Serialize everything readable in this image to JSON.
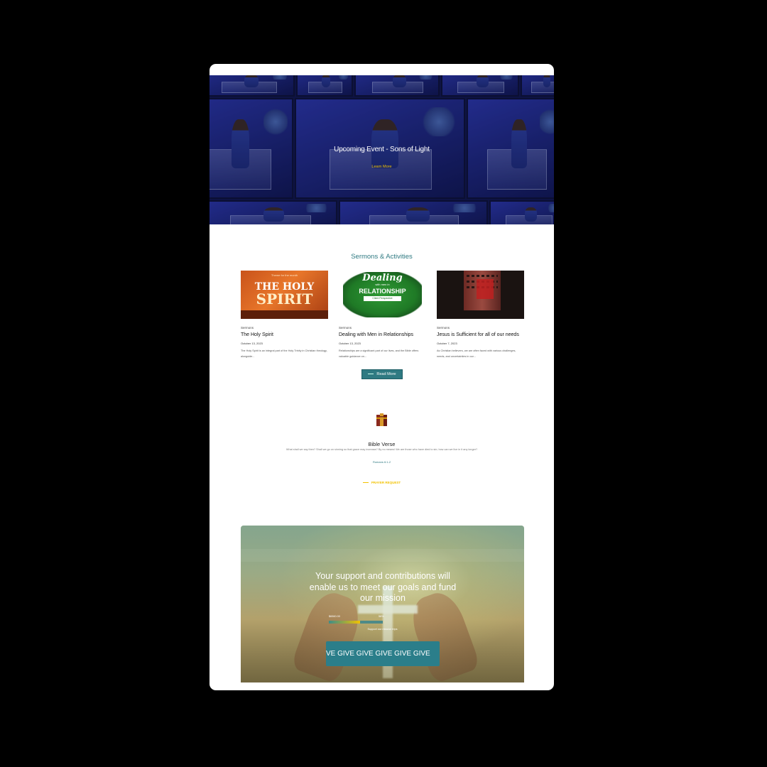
{
  "hero": {
    "title": "Upcoming Event - Sons of Light",
    "link": "Learn More"
  },
  "sermons": {
    "section_title": "Sermons & Activities",
    "cards": [
      {
        "thumb": {
          "small": "Theme for the month",
          "line1": "THE HOLY",
          "line2": "SPIRIT"
        },
        "category": "Sermons",
        "title": "The Holy Spirit",
        "date": "October 13, 2023",
        "excerpt": "The Holy Spirit is an integral part of the Holy Trinity in Christian theology, alongside..."
      },
      {
        "thumb": {
          "line1": "Dealing",
          "line2": "with men in",
          "line3": "RELATIONSHIP",
          "line4": "Client Perspective"
        },
        "category": "Sermons",
        "title": "Dealing with Men in Relationships",
        "date": "October 13, 2023",
        "excerpt": "Relationships are a significant part of our lives, and the Bible offers valuable guidance on..."
      },
      {
        "category": "Sermons",
        "title": "Jesus is Sufficient for all of our needs",
        "date": "October 7, 2023",
        "excerpt": "As Christian believers, we are often faced with various challenges, needs, and uncertainties in our..."
      }
    ],
    "read_more": "Read More"
  },
  "bible": {
    "title": "Bible Verse",
    "text": "What shall we say then? Shall we go on sinning so that grace may increase? By no means! We are those who have died to sin; how can we live in it any longer?",
    "reference": "Romans 6:1-2",
    "prayer_link": "PRAYER REQUEST"
  },
  "support": {
    "heading": "Your support and contributions will enable us to meet our goals and fund our mission",
    "amount": "$6560.00",
    "percent_label": "58%",
    "progress": 0.58,
    "goal_label": "Support our mission trips",
    "give_text": "VE  GIVE  GIVE  GIVE  GIVE  GIVE"
  },
  "colors": {
    "accent_teal": "#2f7a82",
    "accent_gold": "#f2c200",
    "hero_blue": "#1b2478"
  }
}
